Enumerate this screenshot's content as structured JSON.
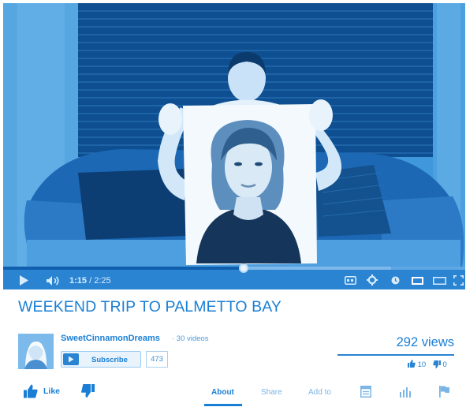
{
  "player": {
    "current_time": "1:15",
    "separator": " / ",
    "total_time": "2:25",
    "progress": 0.52,
    "buffered": 0.84
  },
  "video": {
    "title": "WEEKEND TRIP TO PALMETTO BAY"
  },
  "channel": {
    "name": "SweetCinnamonDreams",
    "video_count": "· 30 videos",
    "subscribe_label": "Subscribe",
    "subscriber_count": "473"
  },
  "stats": {
    "views": "292 views",
    "likes": "10",
    "dislikes": "0"
  },
  "actions": {
    "like_label": "Like",
    "tabs": [
      {
        "label": "About"
      },
      {
        "label": "Share"
      },
      {
        "label": "Add to"
      }
    ]
  },
  "colors": {
    "accent": "#1a7fd4",
    "control_bar": "#2a84d2",
    "muted": "#7ab5e6"
  },
  "icons": {
    "play": "play-icon",
    "volume": "volume-icon",
    "captions": "captions-icon",
    "settings": "gear-icon",
    "watch_later": "clock-icon",
    "small_player": "theater-mode-icon",
    "large_player": "miniplayer-icon",
    "fullscreen": "fullscreen-icon",
    "thumb_up": "thumbs-up-icon",
    "thumb_down": "thumbs-down-icon",
    "transcript": "transcript-icon",
    "statistics": "statistics-icon",
    "flag": "flag-icon"
  }
}
